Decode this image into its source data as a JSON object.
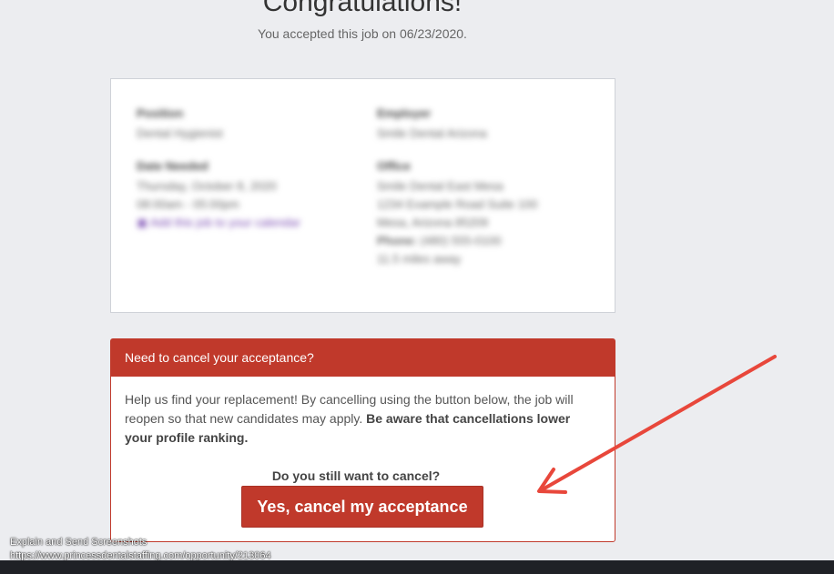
{
  "page": {
    "heading": "Congratulations!",
    "accepted_text": "You accepted this job on 06/23/2020."
  },
  "details": {
    "left": [
      {
        "label": "Position",
        "lines": [
          "Dental Hygienist"
        ]
      },
      {
        "label": "Date Needed",
        "lines": [
          "Thursday, October 8, 2020",
          "08:00am - 05:00pm"
        ],
        "link": "Add this job to your calendar"
      }
    ],
    "right": [
      {
        "label": "Employer",
        "lines": [
          "Smile Dental Arizona"
        ]
      },
      {
        "label": "Office",
        "lines": [
          "Smile Dental East Mesa",
          "1234 Example Road Suite 100",
          "Mesa, Arizona 85209"
        ],
        "phone_label": "Phone:",
        "phone": "(480) 555-0100",
        "extra": "11.5 miles away"
      }
    ]
  },
  "cancel": {
    "header": "Need to cancel your acceptance?",
    "body_text": "Help us find your replacement! By cancelling using the button below, the job will reopen so that new candidates may apply.",
    "body_bold": "Be aware that cancellations lower your profile ranking.",
    "question": "Do you still want to cancel?",
    "button_label": "Yes, cancel my acceptance"
  },
  "overlay": {
    "line1": "Explain and Send Screenshots",
    "line2": "https://www.princessdentalstaffing.com/opportunity/213064"
  },
  "colors": {
    "background": "#ecedf0",
    "danger": "#c0392b",
    "annotation_arrow": "#e8473b"
  }
}
